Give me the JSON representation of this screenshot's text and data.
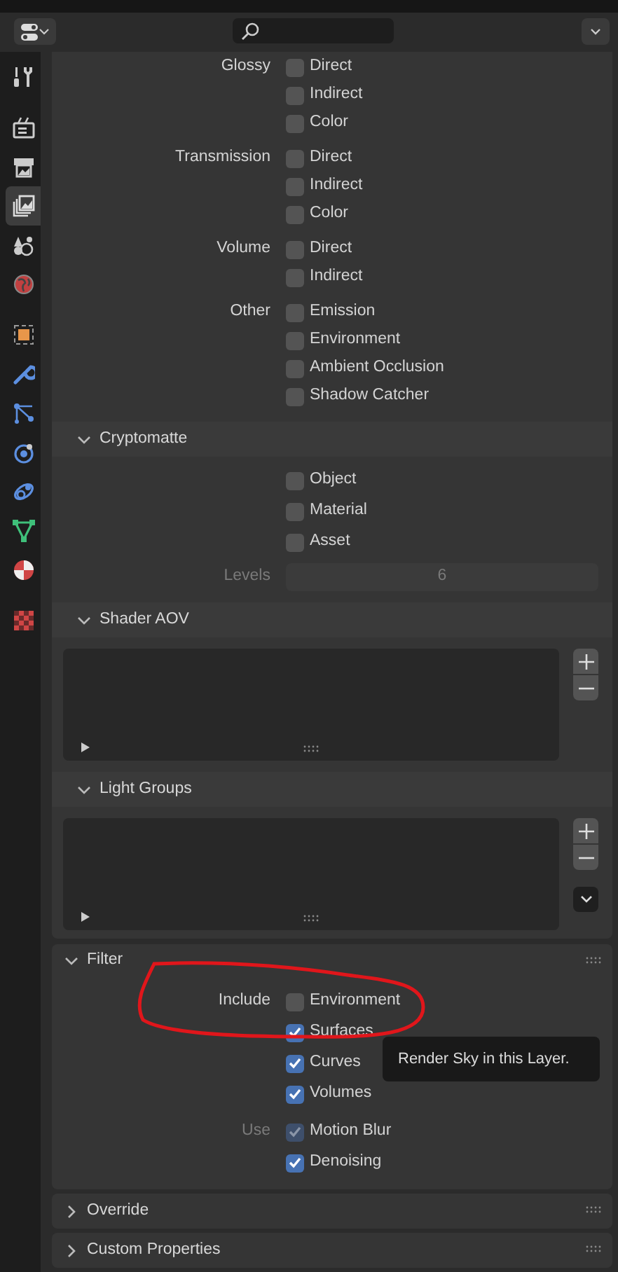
{
  "sidebar": [
    [
      {
        "kind": "tool",
        "selected": false
      }
    ],
    [
      {
        "kind": "render",
        "selected": false
      },
      {
        "kind": "output",
        "selected": false
      },
      {
        "kind": "view_layer",
        "selected": true
      },
      {
        "kind": "scene",
        "selected": false
      },
      {
        "kind": "world",
        "selected": false
      }
    ],
    [
      {
        "kind": "object",
        "selected": false
      },
      {
        "kind": "modifier",
        "selected": false
      },
      {
        "kind": "particles",
        "selected": false
      },
      {
        "kind": "physics",
        "selected": false
      },
      {
        "kind": "constraint",
        "selected": false
      },
      {
        "kind": "data",
        "selected": false
      },
      {
        "kind": "material",
        "selected": false
      }
    ],
    [
      {
        "kind": "texture",
        "selected": false
      }
    ]
  ],
  "passes": [
    {
      "label": "Glossy",
      "options": [
        {
          "label": "Direct",
          "checked": false
        },
        {
          "label": "Indirect",
          "checked": false
        },
        {
          "label": "Color",
          "checked": false
        }
      ]
    },
    {
      "label": "Transmission",
      "options": [
        {
          "label": "Direct",
          "checked": false
        },
        {
          "label": "Indirect",
          "checked": false
        },
        {
          "label": "Color",
          "checked": false
        }
      ]
    },
    {
      "label": "Volume",
      "options": [
        {
          "label": "Direct",
          "checked": false
        },
        {
          "label": "Indirect",
          "checked": false
        }
      ]
    },
    {
      "label": "Other",
      "options": [
        {
          "label": "Emission",
          "checked": false
        },
        {
          "label": "Environment",
          "checked": false
        },
        {
          "label": "Ambient Occlusion",
          "checked": false
        },
        {
          "label": "Shadow Catcher",
          "checked": false
        }
      ]
    }
  ],
  "cryptomatte": {
    "title": "Cryptomatte",
    "expanded": true,
    "options": [
      {
        "label": "Object",
        "checked": false
      },
      {
        "label": "Material",
        "checked": false
      },
      {
        "label": "Asset",
        "checked": false
      }
    ],
    "levels": {
      "label": "Levels",
      "value": "6",
      "disabled": true
    }
  },
  "shader_aov": {
    "title": "Shader AOV",
    "expanded": true
  },
  "light_groups": {
    "title": "Light Groups",
    "expanded": true
  },
  "filter": {
    "title": "Filter",
    "expanded": true,
    "groups": [
      {
        "label": "Include",
        "disabled": false,
        "options": [
          {
            "label": "Environment",
            "checked": false
          },
          {
            "label": "Surfaces",
            "checked": true
          },
          {
            "label": "Curves",
            "checked": true
          },
          {
            "label": "Volumes",
            "checked": true
          }
        ]
      },
      {
        "label": "Use",
        "disabled": true,
        "options": [
          {
            "label": "Motion Blur",
            "checked": true,
            "disabled": true
          },
          {
            "label": "Denoising",
            "checked": true
          }
        ]
      }
    ]
  },
  "collapsed_panels": [
    {
      "title": "Override",
      "expanded": false
    },
    {
      "title": "Custom Properties",
      "expanded": false
    }
  ],
  "tooltip": {
    "text": "Render Sky in this Layer."
  }
}
